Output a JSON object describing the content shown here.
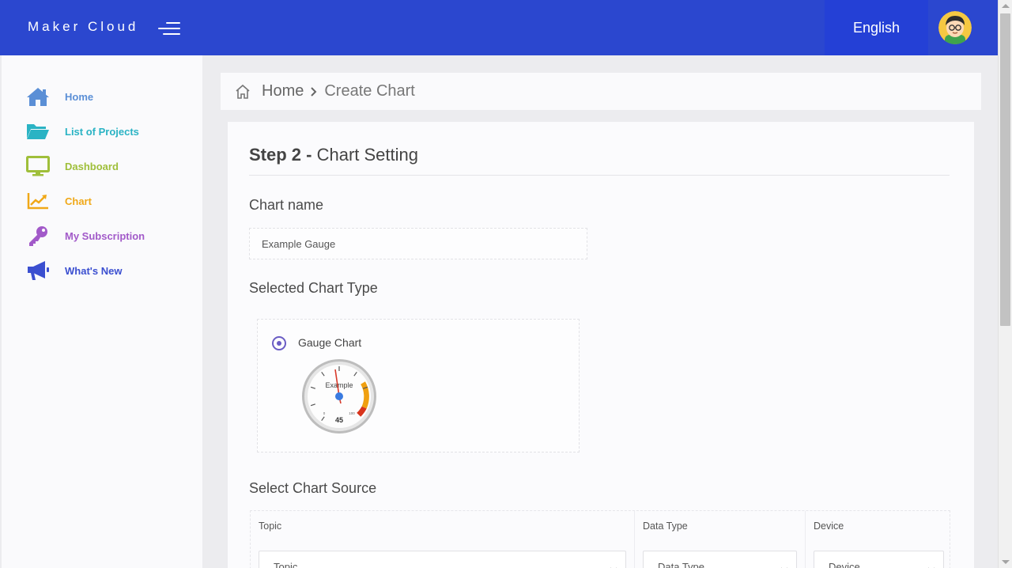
{
  "header": {
    "brand": "Maker Cloud",
    "language": "English"
  },
  "sidebar": {
    "items": [
      {
        "label": "Home",
        "icon": "home-icon",
        "color": "#5b8fd6"
      },
      {
        "label": "List of Projects",
        "icon": "folder-open-icon",
        "color": "#2ab3c4"
      },
      {
        "label": "Dashboard",
        "icon": "monitor-icon",
        "color": "#9fbf3a"
      },
      {
        "label": "Chart",
        "icon": "line-chart-icon",
        "color": "#f0a818"
      },
      {
        "label": "My Subscription",
        "icon": "key-icon",
        "color": "#a25ac9"
      },
      {
        "label": "What's New",
        "icon": "megaphone-icon",
        "color": "#3b4fd0"
      }
    ]
  },
  "breadcrumb": {
    "home": "Home",
    "current": "Create Chart"
  },
  "step": {
    "number": "Step 2 -",
    "title": "Chart Setting"
  },
  "form": {
    "chart_name_label": "Chart name",
    "chart_name_value": "Example Gauge",
    "chart_type_label": "Selected Chart Type",
    "chart_type_option": "Gauge Chart",
    "gauge_preview": {
      "title": "Example",
      "value": "45",
      "min": "0",
      "max": "100"
    },
    "source_label": "Select Chart Source",
    "source_columns": {
      "topic": "Topic",
      "data_type": "Data Type",
      "device": "Device"
    },
    "source_selects": {
      "topic": "Topic",
      "data_type": "Data Type",
      "device": "Device"
    }
  },
  "colors": {
    "header_bg": "#2b47cf",
    "language_bg": "#2440d6",
    "radio_accent": "#6a5cc4"
  }
}
